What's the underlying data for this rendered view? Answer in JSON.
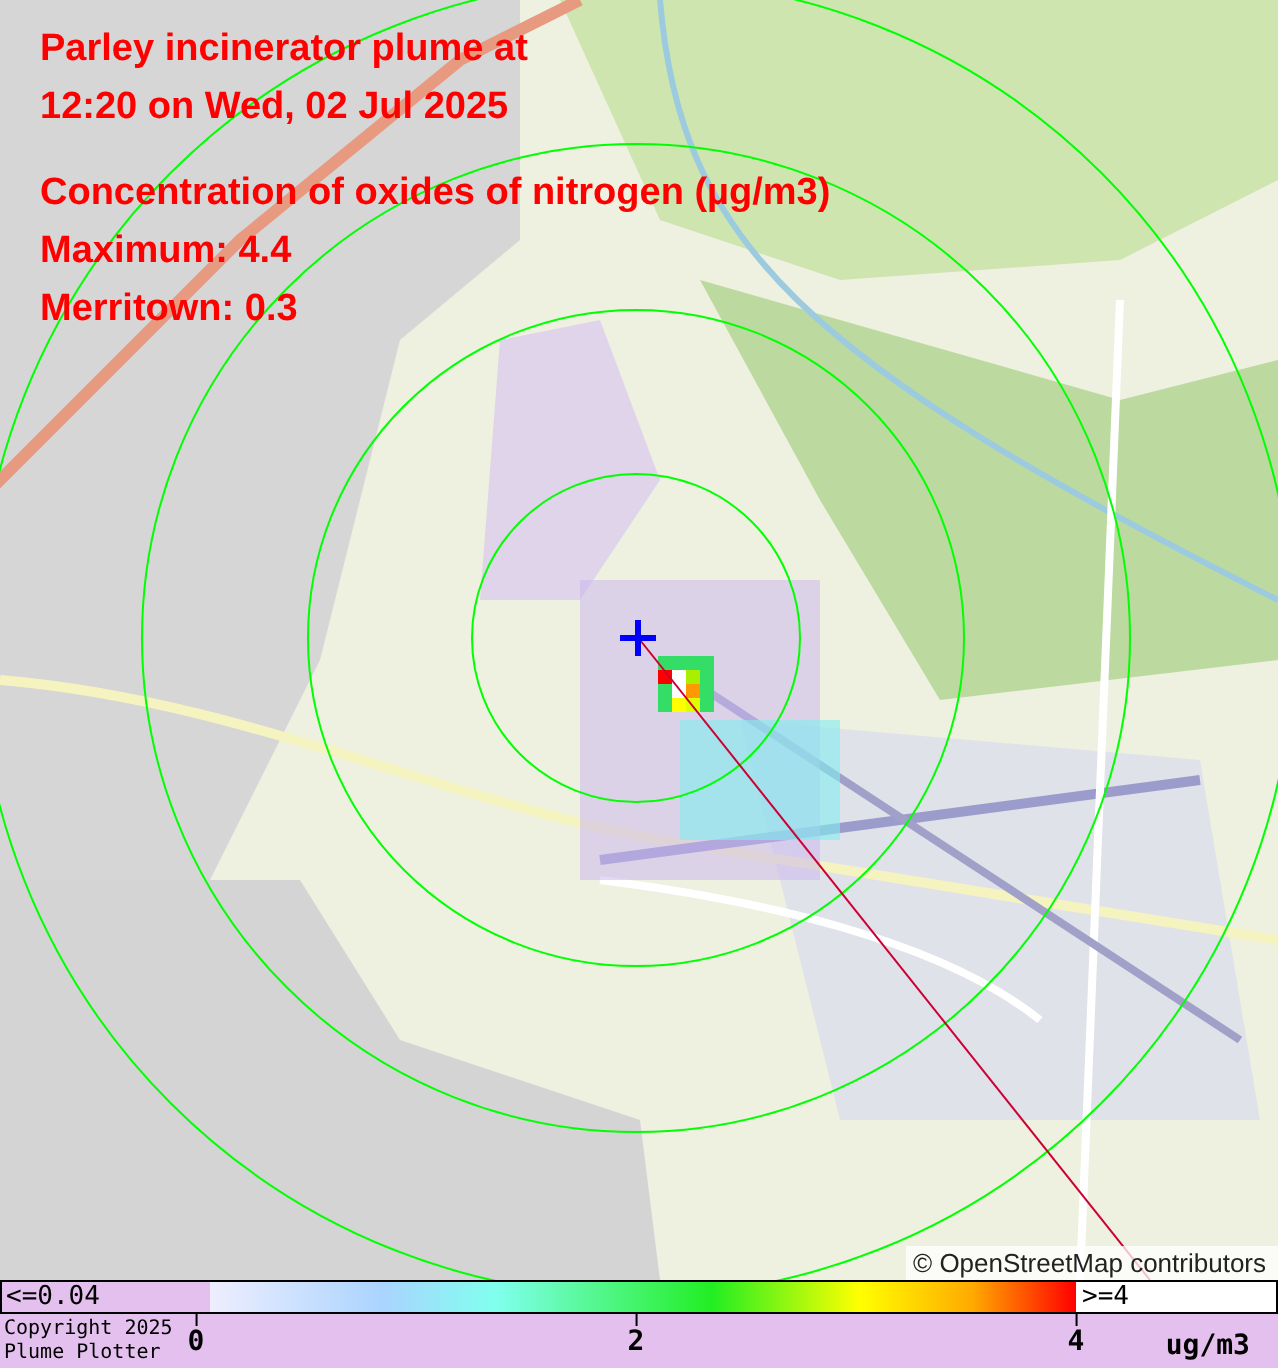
{
  "title_lines": [
    "Parley incinerator plume at",
    "12:20 on Wed, 02 Jul 2025"
  ],
  "pollutant": "Concentration of oxides of nitrogen (µg/m3)",
  "maximum": "Maximum: 4.4",
  "receptor": "Merritown: 0.3",
  "attribution": "© OpenStreetMap contributors",
  "legend": {
    "below_label": "<=0.04",
    "above_label": ">=4",
    "ticks": [
      "0",
      "2",
      "4"
    ],
    "units": "ug/m3",
    "copyright": [
      "Copyright 2025",
      "Plume Plotter"
    ]
  }
}
